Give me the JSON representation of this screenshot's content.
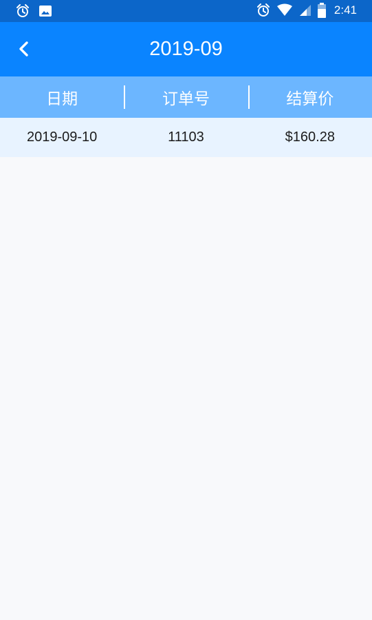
{
  "status_bar": {
    "time": "2:41",
    "left_icons": [
      "alarm-icon",
      "image-icon"
    ],
    "right_icons": [
      "alarm-icon",
      "wifi-icon",
      "signal-icon",
      "battery-icon"
    ]
  },
  "header": {
    "title": "2019-09",
    "back_icon": "chevron-left-icon"
  },
  "table": {
    "columns": [
      "日期",
      "订单号",
      "结算价"
    ],
    "rows": [
      [
        "2019-09-10",
        "11103",
        "$160.28"
      ]
    ]
  },
  "colors": {
    "status_bar": "#0c66c9",
    "app_bar": "#0a84ff",
    "table_header": "#6cb6ff",
    "row_background": "#e8f3ff",
    "page_background": "#f8f9fb"
  }
}
